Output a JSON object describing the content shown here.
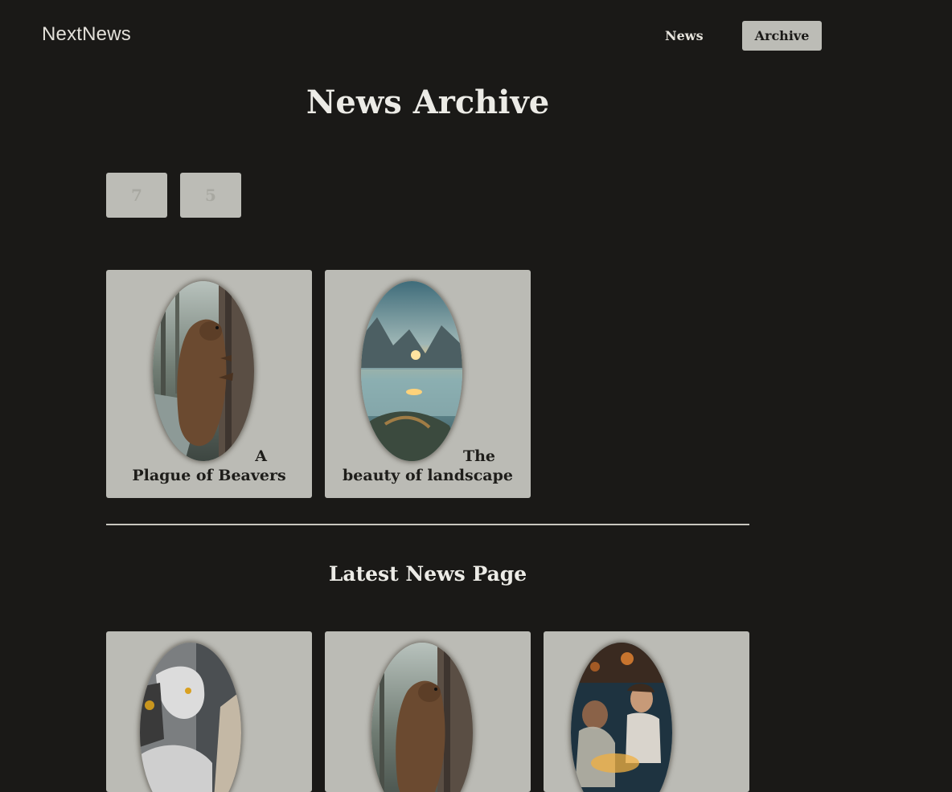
{
  "header": {
    "logo": "NextNews",
    "nav": [
      {
        "label": "News",
        "active": false
      },
      {
        "label": "Archive",
        "active": true
      }
    ]
  },
  "archive": {
    "title": "News Archive",
    "years": [
      "7",
      "5"
    ],
    "items": [
      {
        "caption_line1": "A",
        "caption_line2": "Plague of Beavers",
        "image": "beaver-image"
      },
      {
        "caption_line1": "The",
        "caption_line2": "beauty of landscape",
        "image": "landscape-image"
      }
    ]
  },
  "latest": {
    "title": "Latest News Page",
    "items": [
      {
        "image": "robot-image"
      },
      {
        "image": "beaver-image"
      },
      {
        "image": "chefs-image"
      }
    ]
  },
  "colors": {
    "background": "#1a1917",
    "card": "#bbbbb5",
    "accent": "#bcbcb6"
  }
}
